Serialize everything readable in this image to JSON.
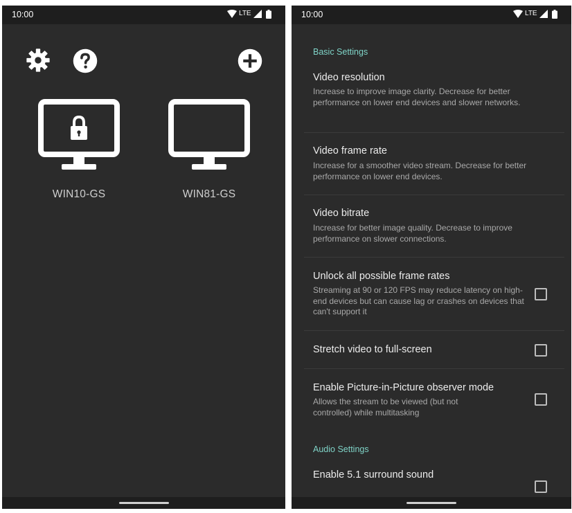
{
  "colors": {
    "background": "#2b2b2b",
    "bars": "#1e1e1e",
    "accent": "#7fd3c7",
    "primary_text": "#ececec",
    "secondary_text": "#a9a9a9"
  },
  "left_screen": {
    "status_bar": {
      "time": "10:00",
      "network": "LTE",
      "icons": [
        "wifi-icon",
        "signal-icon",
        "battery-icon"
      ]
    },
    "toolbar": {
      "icons": [
        "gear-icon",
        "help-icon",
        "add-icon"
      ]
    },
    "computers": [
      {
        "name": "WIN10-GS",
        "icon": "monitor-locked-icon"
      },
      {
        "name": "WIN81-GS",
        "icon": "monitor-icon"
      }
    ]
  },
  "right_screen": {
    "status_bar": {
      "time": "10:00",
      "network": "LTE",
      "icons": [
        "wifi-icon",
        "signal-icon",
        "battery-icon"
      ]
    },
    "sections": [
      {
        "title": "Basic Settings",
        "preferences": [
          {
            "title": "Video resolution",
            "summary": "Increase to improve image clarity. Decrease for better performance on lower end devices and slower networks."
          },
          {
            "title": "Video frame rate",
            "summary": "Increase for a smoother video stream. Decrease for better performance on lower end devices."
          },
          {
            "title": "Video bitrate",
            "summary": "Increase for better image quality. Decrease to improve performance on slower connections."
          },
          {
            "title": "Unlock all possible frame rates",
            "summary": "Streaming at 90 or 120 FPS may reduce latency on high-end devices but can cause lag or crashes on devices that can't support it",
            "checked": false
          },
          {
            "title": "Stretch video to full-screen",
            "checked": false
          },
          {
            "title": "Enable Picture-in-Picture observer mode",
            "summary": "Allows the stream to be viewed (but not controlled) while multitasking",
            "checked": false
          }
        ]
      },
      {
        "title": "Audio Settings",
        "preferences": [
          {
            "title": "Enable 5.1 surround sound",
            "checked": false
          }
        ]
      }
    ]
  }
}
